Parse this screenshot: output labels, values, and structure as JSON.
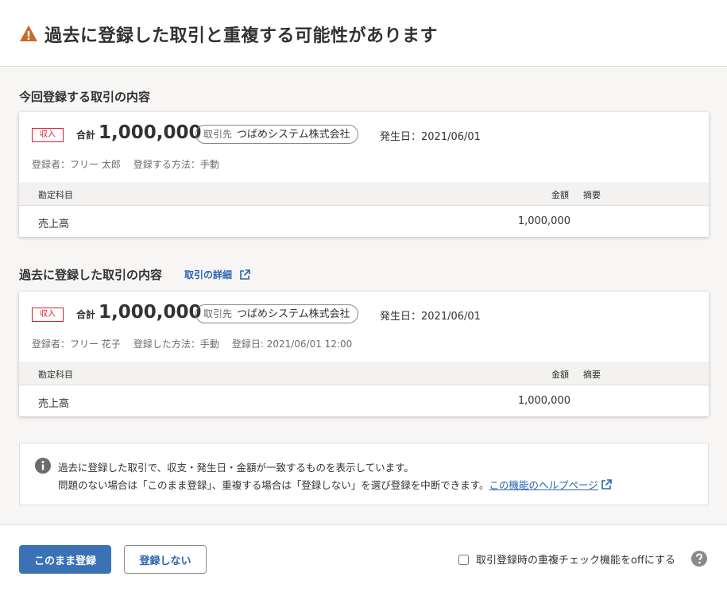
{
  "header": {
    "title": "過去に登録した取引と重複する可能性があります"
  },
  "current_section": {
    "title": "今回登録する取引の内容",
    "card": {
      "badge": "収入",
      "total_label": "合計",
      "total_value": "1,000,000",
      "partner_label": "取引先",
      "partner_value": "つばめシステム株式会社",
      "issue_date": "発生日：2021/06/01",
      "meta": [
        "登録者：フリー 太郎",
        "登録する方法：手動"
      ],
      "columns": {
        "account": "勘定科目",
        "amount": "金額",
        "description": "摘要"
      },
      "row": {
        "account": "売上高",
        "amount": "1,000,000",
        "description": ""
      }
    }
  },
  "past_section": {
    "title": "過去に登録した取引の内容",
    "detail_link": "取引の詳細",
    "card": {
      "badge": "収入",
      "total_label": "合計",
      "total_value": "1,000,000",
      "partner_label": "取引先",
      "partner_value": "つばめシステム株式会社",
      "issue_date": "発生日：2021/06/01",
      "meta": [
        "登録者：フリー 花子",
        "登録した方法：手動",
        "登録日: 2021/06/01 12:00"
      ],
      "columns": {
        "account": "勘定科目",
        "amount": "金額",
        "description": "摘要"
      },
      "row": {
        "account": "売上高",
        "amount": "1,000,000",
        "description": ""
      }
    }
  },
  "notice": {
    "line1": "過去に登録した取引で、収支・発生日・金額が一致するものを表示しています。",
    "line2": "問題のない場合は「このまま登録」、重複する場合は「登録しない」を選び登録を中断できます。",
    "help_link": "この機能のヘルプページ"
  },
  "footer": {
    "register_button": "このまま登録",
    "cancel_button": "登録しない",
    "checkbox_label": "取引登録時の重複チェック機能をoffにする",
    "checkbox_checked": false
  },
  "icons": {
    "warning": "warning-icon",
    "external_link": "external-link-icon",
    "info": "info-icon",
    "help": "help-icon"
  },
  "colors": {
    "warning": "#c8692a",
    "income_badge": "#dc1e32",
    "link": "#2864b4",
    "primary_button": "#3a72b5"
  }
}
